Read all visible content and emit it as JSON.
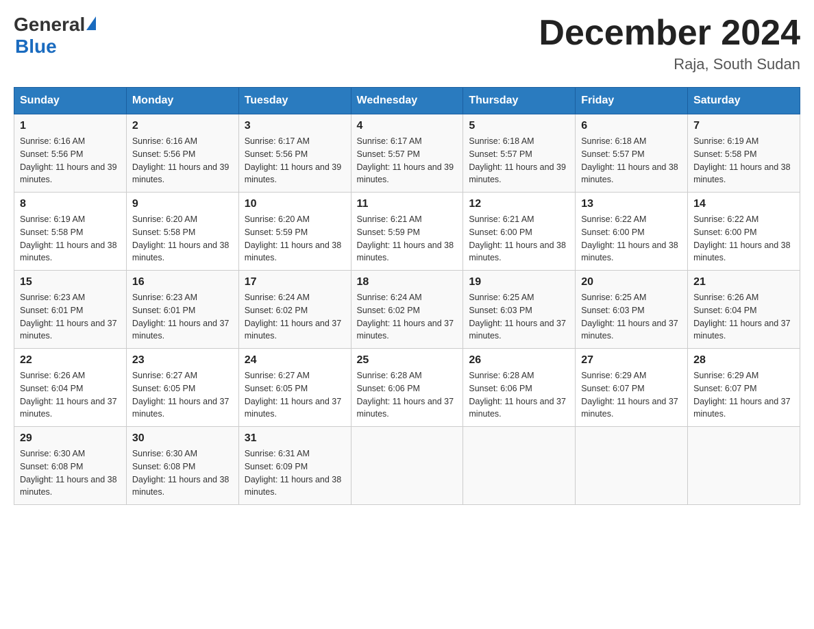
{
  "header": {
    "logo_general": "General",
    "logo_blue": "Blue",
    "title": "December 2024",
    "location": "Raja, South Sudan"
  },
  "columns": [
    "Sunday",
    "Monday",
    "Tuesday",
    "Wednesday",
    "Thursday",
    "Friday",
    "Saturday"
  ],
  "weeks": [
    [
      {
        "day": "1",
        "sunrise": "6:16 AM",
        "sunset": "5:56 PM",
        "daylight": "11 hours and 39 minutes."
      },
      {
        "day": "2",
        "sunrise": "6:16 AM",
        "sunset": "5:56 PM",
        "daylight": "11 hours and 39 minutes."
      },
      {
        "day": "3",
        "sunrise": "6:17 AM",
        "sunset": "5:56 PM",
        "daylight": "11 hours and 39 minutes."
      },
      {
        "day": "4",
        "sunrise": "6:17 AM",
        "sunset": "5:57 PM",
        "daylight": "11 hours and 39 minutes."
      },
      {
        "day": "5",
        "sunrise": "6:18 AM",
        "sunset": "5:57 PM",
        "daylight": "11 hours and 39 minutes."
      },
      {
        "day": "6",
        "sunrise": "6:18 AM",
        "sunset": "5:57 PM",
        "daylight": "11 hours and 38 minutes."
      },
      {
        "day": "7",
        "sunrise": "6:19 AM",
        "sunset": "5:58 PM",
        "daylight": "11 hours and 38 minutes."
      }
    ],
    [
      {
        "day": "8",
        "sunrise": "6:19 AM",
        "sunset": "5:58 PM",
        "daylight": "11 hours and 38 minutes."
      },
      {
        "day": "9",
        "sunrise": "6:20 AM",
        "sunset": "5:58 PM",
        "daylight": "11 hours and 38 minutes."
      },
      {
        "day": "10",
        "sunrise": "6:20 AM",
        "sunset": "5:59 PM",
        "daylight": "11 hours and 38 minutes."
      },
      {
        "day": "11",
        "sunrise": "6:21 AM",
        "sunset": "5:59 PM",
        "daylight": "11 hours and 38 minutes."
      },
      {
        "day": "12",
        "sunrise": "6:21 AM",
        "sunset": "6:00 PM",
        "daylight": "11 hours and 38 minutes."
      },
      {
        "day": "13",
        "sunrise": "6:22 AM",
        "sunset": "6:00 PM",
        "daylight": "11 hours and 38 minutes."
      },
      {
        "day": "14",
        "sunrise": "6:22 AM",
        "sunset": "6:00 PM",
        "daylight": "11 hours and 38 minutes."
      }
    ],
    [
      {
        "day": "15",
        "sunrise": "6:23 AM",
        "sunset": "6:01 PM",
        "daylight": "11 hours and 37 minutes."
      },
      {
        "day": "16",
        "sunrise": "6:23 AM",
        "sunset": "6:01 PM",
        "daylight": "11 hours and 37 minutes."
      },
      {
        "day": "17",
        "sunrise": "6:24 AM",
        "sunset": "6:02 PM",
        "daylight": "11 hours and 37 minutes."
      },
      {
        "day": "18",
        "sunrise": "6:24 AM",
        "sunset": "6:02 PM",
        "daylight": "11 hours and 37 minutes."
      },
      {
        "day": "19",
        "sunrise": "6:25 AM",
        "sunset": "6:03 PM",
        "daylight": "11 hours and 37 minutes."
      },
      {
        "day": "20",
        "sunrise": "6:25 AM",
        "sunset": "6:03 PM",
        "daylight": "11 hours and 37 minutes."
      },
      {
        "day": "21",
        "sunrise": "6:26 AM",
        "sunset": "6:04 PM",
        "daylight": "11 hours and 37 minutes."
      }
    ],
    [
      {
        "day": "22",
        "sunrise": "6:26 AM",
        "sunset": "6:04 PM",
        "daylight": "11 hours and 37 minutes."
      },
      {
        "day": "23",
        "sunrise": "6:27 AM",
        "sunset": "6:05 PM",
        "daylight": "11 hours and 37 minutes."
      },
      {
        "day": "24",
        "sunrise": "6:27 AM",
        "sunset": "6:05 PM",
        "daylight": "11 hours and 37 minutes."
      },
      {
        "day": "25",
        "sunrise": "6:28 AM",
        "sunset": "6:06 PM",
        "daylight": "11 hours and 37 minutes."
      },
      {
        "day": "26",
        "sunrise": "6:28 AM",
        "sunset": "6:06 PM",
        "daylight": "11 hours and 37 minutes."
      },
      {
        "day": "27",
        "sunrise": "6:29 AM",
        "sunset": "6:07 PM",
        "daylight": "11 hours and 37 minutes."
      },
      {
        "day": "28",
        "sunrise": "6:29 AM",
        "sunset": "6:07 PM",
        "daylight": "11 hours and 37 minutes."
      }
    ],
    [
      {
        "day": "29",
        "sunrise": "6:30 AM",
        "sunset": "6:08 PM",
        "daylight": "11 hours and 38 minutes."
      },
      {
        "day": "30",
        "sunrise": "6:30 AM",
        "sunset": "6:08 PM",
        "daylight": "11 hours and 38 minutes."
      },
      {
        "day": "31",
        "sunrise": "6:31 AM",
        "sunset": "6:09 PM",
        "daylight": "11 hours and 38 minutes."
      },
      null,
      null,
      null,
      null
    ]
  ]
}
